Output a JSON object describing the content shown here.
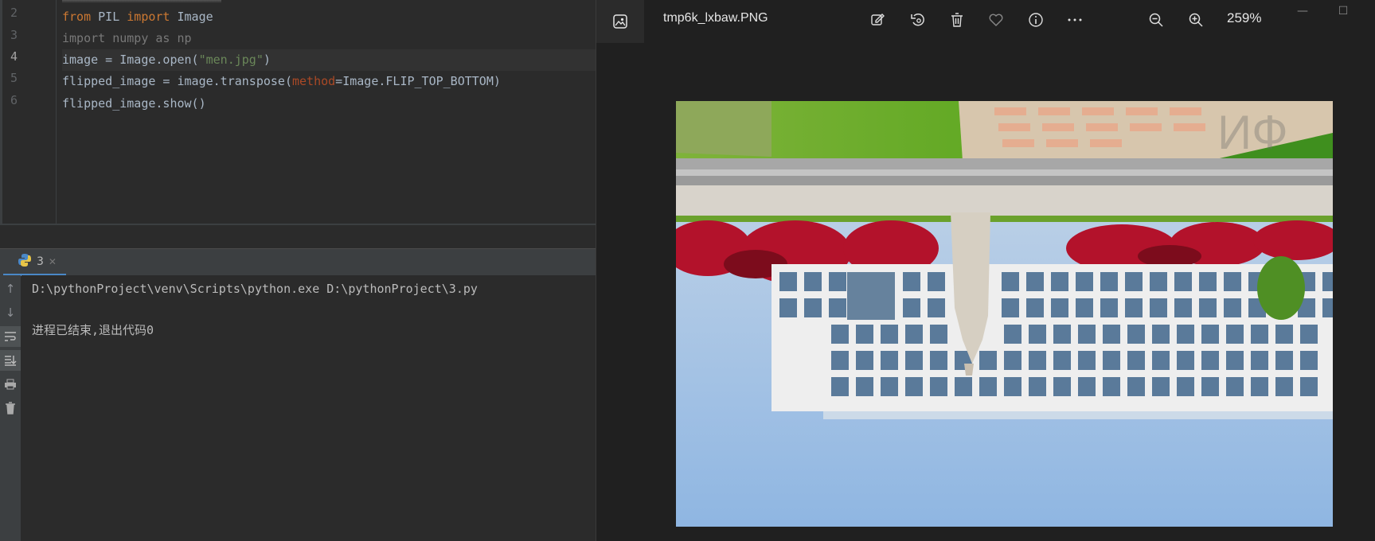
{
  "editor": {
    "line_numbers": [
      "2",
      "3",
      "4",
      "5",
      "6"
    ],
    "code_lines": {
      "l2": {
        "kw1": "from",
        "mod": " PIL ",
        "kw2": "import",
        "name": " Image"
      },
      "l3": {
        "text": "import numpy as np"
      },
      "l4": {
        "pre": "image = Image.open(",
        "str": "\"men.jpg\"",
        "post": ")"
      },
      "l5": {
        "pre": "flipped_image = image.transpose(",
        "param": "method",
        "post": "=Image.FLIP_TOP_BOTTOM)"
      },
      "l6": {
        "text": "flipped_image.show()"
      }
    }
  },
  "run_panel": {
    "tab_label": "3",
    "output_lines": [
      "D:\\pythonProject\\venv\\Scripts\\python.exe D:\\pythonProject\\3.py",
      "进程已结束,退出代码0"
    ]
  },
  "viewer": {
    "filename": "tmp6k_lxbaw.PNG",
    "zoom": "259%",
    "toolbar_icons": [
      "edit-image-icon",
      "rotate-icon",
      "delete-icon",
      "favorite-icon",
      "info-icon",
      "more-icon",
      "zoom-out-icon",
      "zoom-in-icon"
    ]
  },
  "colors": {
    "ide_bg": "#2b2b2b",
    "keyword": "#cc7832",
    "string": "#6a8759",
    "param": "#aa4926",
    "viewer_bg": "#202020"
  }
}
